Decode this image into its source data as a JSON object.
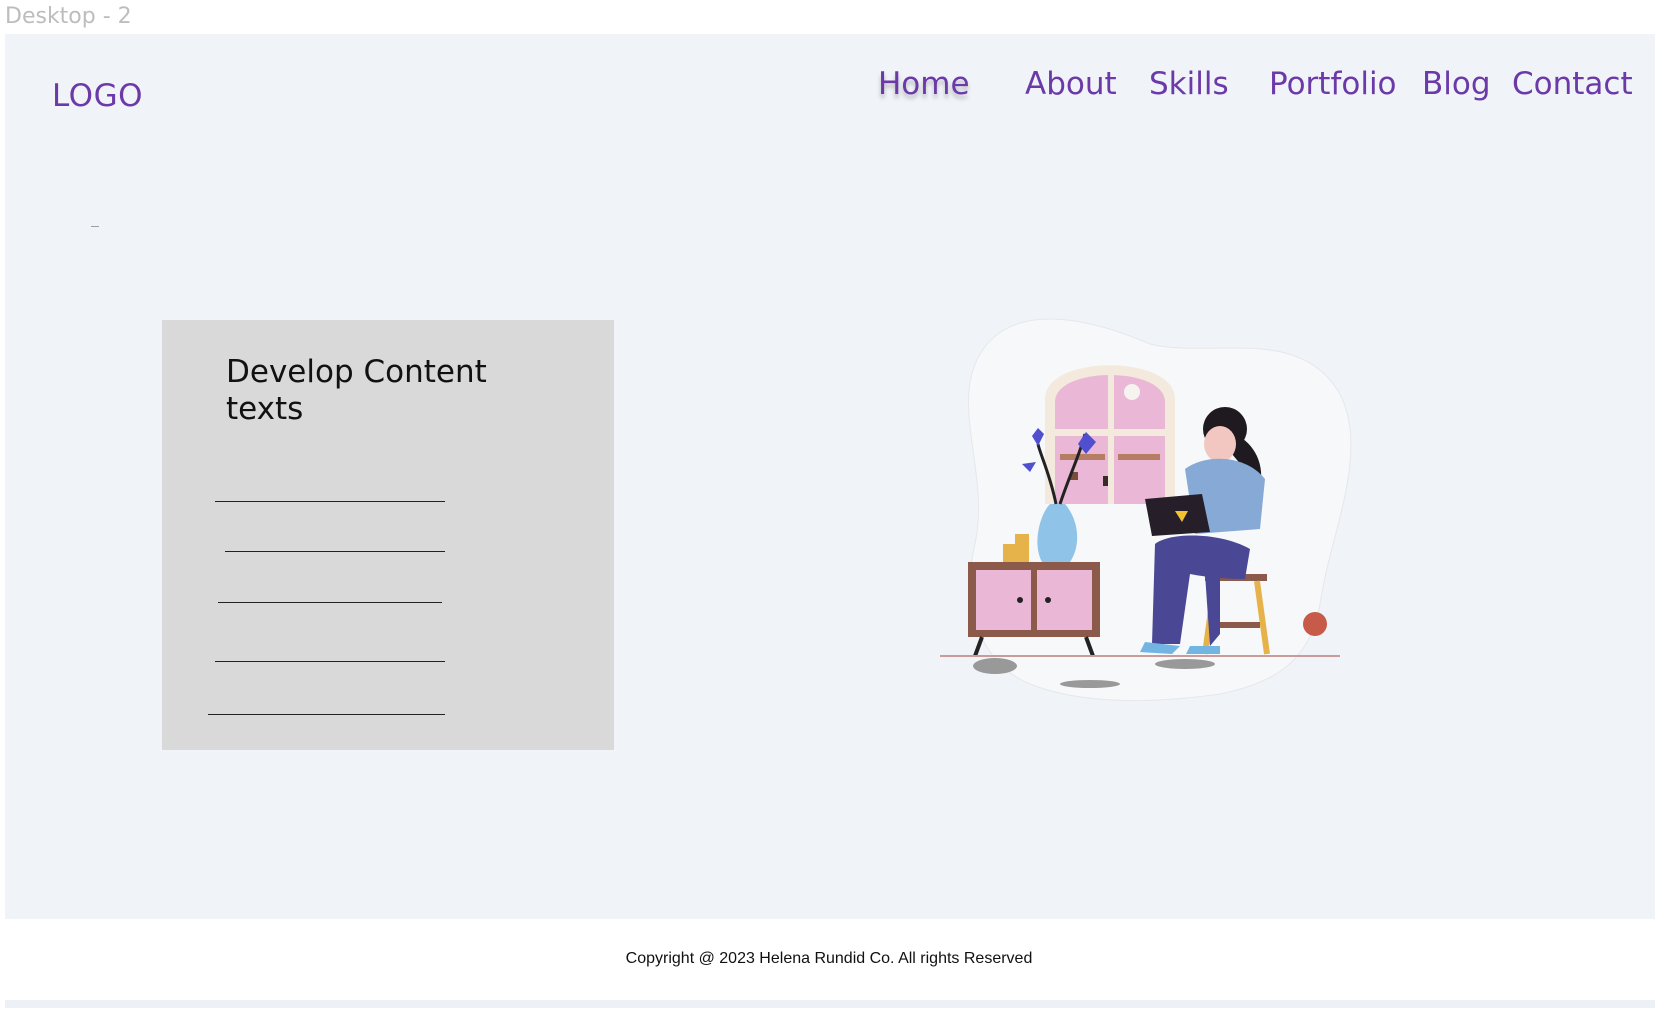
{
  "frame": {
    "label": "Desktop - 2"
  },
  "header": {
    "logo": "LOGO",
    "nav": [
      {
        "label": "Home",
        "active": true
      },
      {
        "label": "About"
      },
      {
        "label": "Skills"
      },
      {
        "label": "Portfolio"
      },
      {
        "label": "Blog"
      },
      {
        "label": "Contact"
      }
    ]
  },
  "main": {
    "card": {
      "title": "Develop Content texts"
    }
  },
  "illustration": {
    "icon": "woman-working-on-laptop-illustration"
  },
  "footer": {
    "copyright": "Copyright @ 2023 Helena Rundid Co. All rights Reserved"
  },
  "colors": {
    "accent": "#6b3aa8",
    "canvas": "#f0f3f8",
    "card": "#d9d9d9"
  }
}
